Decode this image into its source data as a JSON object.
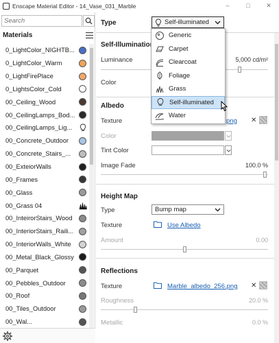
{
  "window": {
    "title": "Enscape Material Editor - 14_Vase_031_Marble",
    "controls": [
      "–",
      "□",
      "✕"
    ]
  },
  "sidebar": {
    "search_placeholder": "Search",
    "header": "Materials",
    "items": [
      {
        "name": "0_LightColor_NIGHTB...",
        "swatch": "#4a6fc4",
        "kind": "circle"
      },
      {
        "name": "0_LightColor_Warm",
        "swatch": "#f0a35a",
        "kind": "circle"
      },
      {
        "name": "0_LightFirePlace",
        "swatch": "#f0a868",
        "kind": "circle"
      },
      {
        "name": "0_LightsColor_Cold",
        "swatch": "#f6fbff",
        "kind": "circle"
      },
      {
        "name": "00_Ceiling_Wood",
        "swatch": "#4a3b32",
        "kind": "circle"
      },
      {
        "name": "00_CeilingLamps_Bod...",
        "swatch": "#2a2a2a",
        "kind": "circle"
      },
      {
        "name": "00_CeilingLamps_Lig...",
        "swatch": "",
        "kind": "bulb-icon"
      },
      {
        "name": "00_Concrete_Outdoor",
        "swatch": "#a9c4e6",
        "kind": "circle"
      },
      {
        "name": "00_Concrete_Stairs_...",
        "swatch": "#bdbdbd",
        "kind": "circle"
      },
      {
        "name": "00_ExteiorWalls",
        "swatch": "#202020",
        "kind": "circle"
      },
      {
        "name": "00_Frames",
        "swatch": "#363636",
        "kind": "circle"
      },
      {
        "name": "00_Glass",
        "swatch": "#9a9a9a",
        "kind": "circle"
      },
      {
        "name": "00_Grass 04",
        "swatch": "",
        "kind": "grass-icon"
      },
      {
        "name": "00_InteirorStairs_Wood",
        "swatch": "#8a8a8a",
        "kind": "circle"
      },
      {
        "name": "00_InteriorStairs_Raili...",
        "swatch": "#a0a0a0",
        "kind": "circle"
      },
      {
        "name": "00_InteriorWalls_White",
        "swatch": "#d2d2d2",
        "kind": "circle"
      },
      {
        "name": "00_Metal_Black_Glossy",
        "swatch": "#1a1a1a",
        "kind": "circle"
      },
      {
        "name": "00_Parquet",
        "swatch": "#555555",
        "kind": "circle"
      },
      {
        "name": "00_Pebbles_Outdoor",
        "swatch": "#8c8c8c",
        "kind": "circle"
      },
      {
        "name": "00_Roof",
        "swatch": "#777777",
        "kind": "circle"
      },
      {
        "name": "00_Tiles_Outdoor",
        "swatch": "#9a9a9a",
        "kind": "circle"
      },
      {
        "name": "00_Wal...",
        "swatch": "#555555",
        "kind": "circle"
      }
    ]
  },
  "editor": {
    "type_label": "Type",
    "type_value": "Self-illuminated",
    "type_options": [
      "Generic",
      "Carpet",
      "Clearcoat",
      "Foliage",
      "Grass",
      "Self-illuminated",
      "Water"
    ],
    "type_selected": "Self-illuminated",
    "self_illumination": {
      "title": "Self-Illumination",
      "luminance_label": "Luminance",
      "luminance_value": "5,000 cd/m²",
      "color_label": "Color"
    },
    "albedo": {
      "title": "Albedo",
      "texture_label": "Texture",
      "texture_link": "png",
      "color_label": "Color",
      "tint_color_label": "Tint Color",
      "image_fade_label": "Image Fade",
      "image_fade_value": "100.0 %",
      "image_fade_fraction": 1.0
    },
    "height_map": {
      "title": "Height Map",
      "type_label": "Type",
      "type_value": "Bump map",
      "texture_label": "Texture",
      "texture_link": "Use Albedo",
      "amount_label": "Amount",
      "amount_value": "0.00",
      "amount_fraction": 0.5
    },
    "reflections": {
      "title": "Reflections",
      "texture_label": "Texture",
      "texture_link": "Marble_albedo_256.png",
      "roughness_label": "Roughness",
      "roughness_value": "20.0 %",
      "roughness_fraction": 0.2,
      "metallic_label": "Metallic",
      "metallic_value": "0.0 %"
    }
  }
}
